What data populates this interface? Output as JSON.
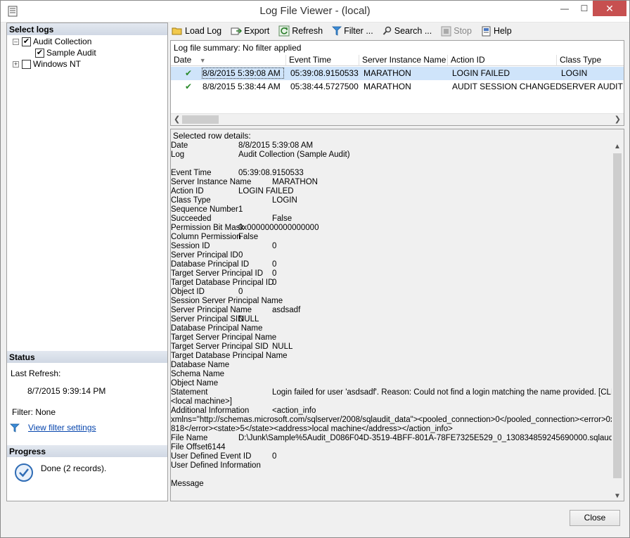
{
  "window": {
    "title": "Log File Viewer - (local)"
  },
  "left": {
    "select_logs_header": "Select logs",
    "tree": [
      {
        "label": "Audit Collection",
        "checked": true,
        "expanded": true
      },
      {
        "label": "Sample Audit",
        "checked": true
      },
      {
        "label": "Windows NT",
        "checked": false,
        "expanded": false
      }
    ],
    "status_header": "Status",
    "last_refresh_label": "Last Refresh:",
    "last_refresh_value": "8/7/2015 9:39:14 PM",
    "filter_label": "Filter: None",
    "view_filter_link": "View filter settings",
    "progress_header": "Progress",
    "progress_text": "Done (2 records)."
  },
  "toolbar": {
    "load_log": "Load Log",
    "export": "Export",
    "refresh": "Refresh",
    "filter": "Filter ...",
    "search": "Search ...",
    "stop": "Stop",
    "help": "Help"
  },
  "grid": {
    "summary": "Log file summary: No filter applied",
    "columns": [
      "Date",
      "Event Time",
      "Server Instance Name",
      "Action ID",
      "Class Type"
    ],
    "rows": [
      [
        "8/8/2015 5:39:08 AM",
        "05:39:08.9150533",
        "MARATHON",
        "LOGIN FAILED",
        "LOGIN"
      ],
      [
        "8/8/2015 5:38:44 AM",
        "05:38:44.5727500",
        "MARATHON",
        "AUDIT SESSION CHANGED",
        "SERVER AUDIT"
      ]
    ]
  },
  "details": {
    "title": "Selected row details:",
    "lines": [
      {
        "label": "Date",
        "value": "8/8/2015 5:39:08 AM"
      },
      {
        "label": "Log",
        "value": "Audit Collection (Sample Audit)"
      },
      {
        "label": "",
        "value": ""
      },
      {
        "label": "Event Time",
        "value": "05:39:08.9150533"
      },
      {
        "label": "Server Instance Name",
        "value": "MARATHON"
      },
      {
        "label": "Action ID",
        "value": "LOGIN FAILED"
      },
      {
        "label": "Class Type",
        "value": "LOGIN"
      },
      {
        "label": "Sequence Number",
        "value": "1"
      },
      {
        "label": "Succeeded",
        "value": "False"
      },
      {
        "label": "Permission Bit Mask",
        "value": "0x0000000000000000"
      },
      {
        "label": "Column Permission",
        "value": "False"
      },
      {
        "label": "Session ID",
        "value": "0"
      },
      {
        "label": "Server Principal ID",
        "value": "0"
      },
      {
        "label": "Database Principal ID",
        "value": "0"
      },
      {
        "label": "Target Server Principal ID",
        "value": "0"
      },
      {
        "label": "Target Database Principal ID",
        "value": "0"
      },
      {
        "label": "Object ID",
        "value": "0"
      },
      {
        "label": "Session Server Principal Name",
        "value": ""
      },
      {
        "label": "Server Principal Name",
        "value": "asdsadf"
      },
      {
        "label": "Server Principal SID",
        "value": "NULL"
      },
      {
        "label": "Database Principal Name",
        "value": ""
      },
      {
        "label": "Target Server Principal Name",
        "value": ""
      },
      {
        "label": "Target Server Principal SID",
        "value": "NULL"
      },
      {
        "label": "Target Database Principal Name",
        "value": ""
      },
      {
        "label": "Database Name",
        "value": ""
      },
      {
        "label": "Schema Name",
        "value": ""
      },
      {
        "label": "Object Name",
        "value": ""
      },
      {
        "label": "Statement",
        "value": "Login failed for user 'asdsadf'. Reason: Could not find a login matching the name provided. [CLIENT:"
      },
      {
        "label": "<local machine>]",
        "value": ""
      },
      {
        "label": "Additional Information",
        "value": "<action_info"
      },
      {
        "label": "xmlns=\"http://schemas.microsoft.com/sqlserver/2008/sqlaudit_data\"><pooled_connection>0</pooled_connection><error>0x00004",
        "value": ""
      },
      {
        "label": "818</error><state>5</state><address>local machine</address></action_info>",
        "value": ""
      },
      {
        "label": "File Name",
        "value": "D:\\Junk\\Sample%5Audit_D086F04D-3519-4BFF-801A-78FE7325E529_0_130834859245690000.sqlaudit"
      },
      {
        "label": "File Offset",
        "value": "6144"
      },
      {
        "label": "User Defined Event ID",
        "value": "0"
      },
      {
        "label": "User Defined Information",
        "value": ""
      },
      {
        "label": "",
        "value": ""
      },
      {
        "label": "Message",
        "value": ""
      }
    ]
  },
  "close_button": "Close"
}
